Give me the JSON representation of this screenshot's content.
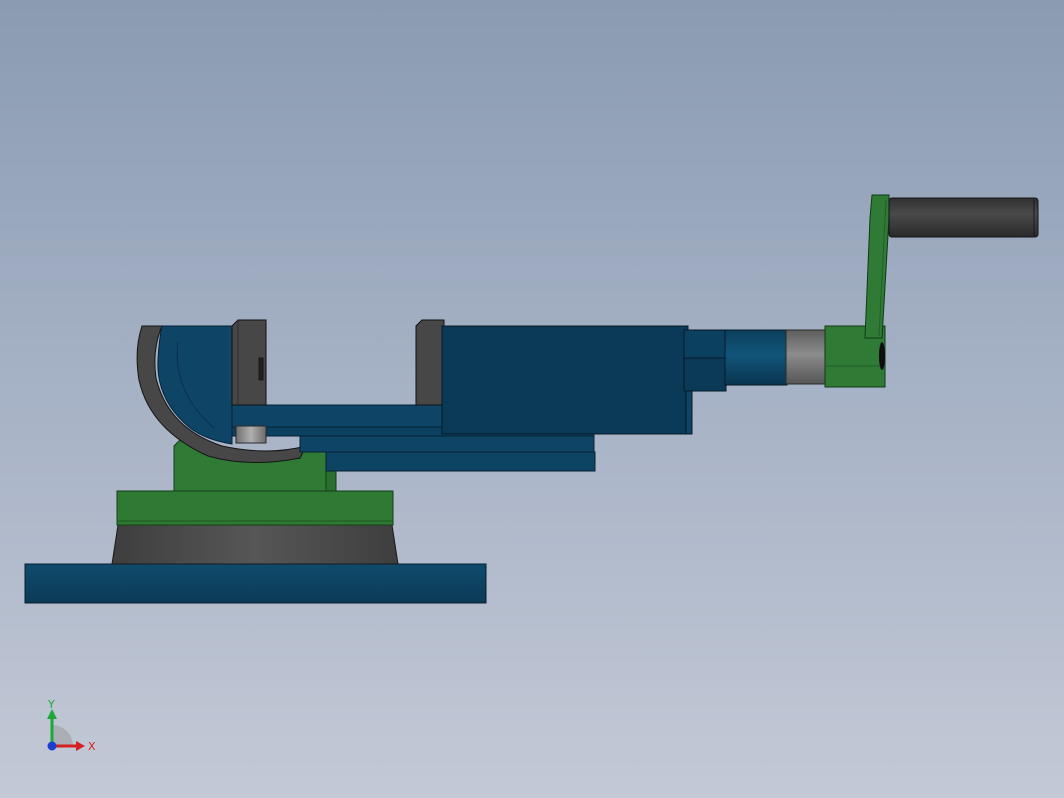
{
  "viewport": {
    "background_top": "#8a9bb2",
    "background_bottom": "#c3c9d6"
  },
  "model": {
    "colors": {
      "blue_body": "#0e4566",
      "blue_dark": "#0b3650",
      "blue_edge": "#072638",
      "green_body": "#2f7a35",
      "green_dark": "#245e29",
      "gray_dark": "#474747",
      "gray_mid": "#5d5d5d",
      "gray_light": "#8a8a8a",
      "edge": "#101010"
    }
  },
  "triad": {
    "x_label": "X",
    "y_label": "Y",
    "x_color": "#d42020",
    "y_color": "#1fa83a",
    "z_color": "#1d3fd0"
  }
}
